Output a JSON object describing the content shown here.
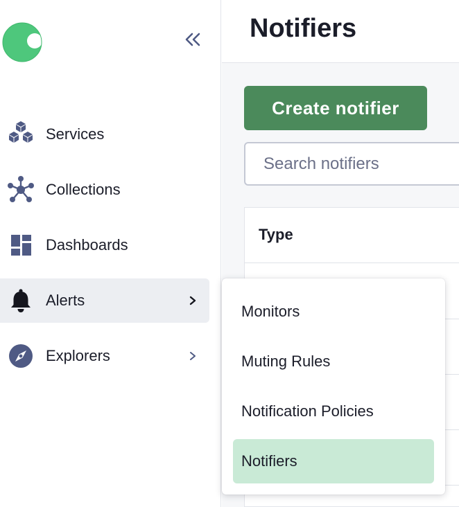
{
  "sidebar": {
    "logo": "logo-icon",
    "collapse": "double-chevron-left-icon",
    "items": [
      {
        "label": "Services",
        "icon": "cubes-icon"
      },
      {
        "label": "Collections",
        "icon": "network-icon"
      },
      {
        "label": "Dashboards",
        "icon": "dashboard-icon"
      },
      {
        "label": "Alerts",
        "icon": "bell-icon",
        "active": true,
        "has_submenu": true
      },
      {
        "label": "Explorers",
        "icon": "compass-icon",
        "has_submenu": true
      }
    ]
  },
  "alerts_submenu": {
    "items": [
      {
        "label": "Monitors"
      },
      {
        "label": "Muting Rules"
      },
      {
        "label": "Notification Policies"
      },
      {
        "label": "Notifiers",
        "selected": true
      }
    ]
  },
  "main": {
    "title": "Notifiers",
    "create_button_label": "Create notifier",
    "search": {
      "placeholder": "Search notifiers",
      "value": ""
    },
    "table": {
      "columns": [
        "Type"
      ]
    }
  },
  "colors": {
    "brand_green": "#4ec77c",
    "primary_button": "#4b8a5b",
    "icon_slate": "#4f5a84",
    "selected_item_bg": "#c9ead6",
    "active_nav_bg": "#eceef2"
  }
}
